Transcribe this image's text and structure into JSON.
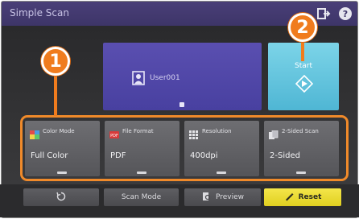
{
  "app": {
    "title": "Simple Scan"
  },
  "user_tile": {
    "name": "User001"
  },
  "start_tile": {
    "label": "Start"
  },
  "settings": [
    {
      "title": "Color Mode",
      "value": "Full Color",
      "icon": "color-mode-icon"
    },
    {
      "title": "File Format",
      "value": "PDF",
      "icon": "file-format-icon"
    },
    {
      "title": "Resolution",
      "value": "400dpi",
      "icon": "resolution-icon"
    },
    {
      "title": "2-Sided Scan",
      "value": "2-Sided",
      "icon": "two-sided-icon"
    }
  ],
  "bottom_bar": {
    "scan_mode_label": "Scan Mode",
    "preview_label": "Preview",
    "reset_label": "Reset"
  },
  "callouts": {
    "one": "1",
    "two": "2"
  },
  "colors": {
    "title_bar": "#3d3568",
    "user_tile": "#4840a0",
    "start_tile": "#4fb6d4",
    "callout": "#f07c1e",
    "reset_button": "#e0cf20"
  }
}
